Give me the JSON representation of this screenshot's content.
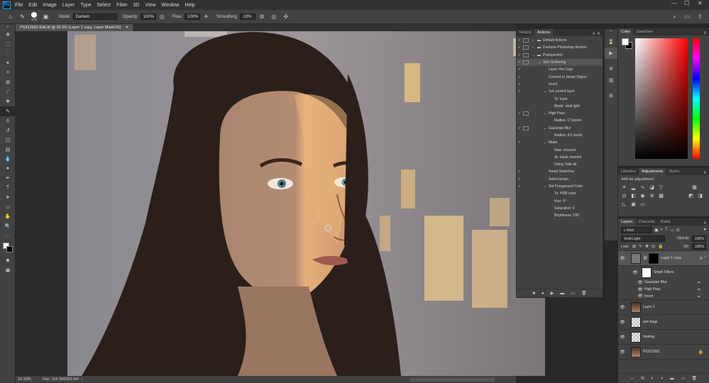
{
  "app": {
    "logo": "Ps"
  },
  "menu": [
    "File",
    "Edit",
    "Image",
    "Layer",
    "Type",
    "Select",
    "Filter",
    "3D",
    "View",
    "Window",
    "Help"
  ],
  "window_controls": {
    "minimize": "—",
    "maximize": "☐",
    "close": "✕"
  },
  "options": {
    "brush_size": "175",
    "mode_label": "Mode:",
    "mode_value": "Darken",
    "opacity_label": "Opacity:",
    "opacity_value": "100%",
    "flow_label": "Flow:",
    "flow_value": "100%",
    "smoothing_label": "Smoothing:",
    "smoothing_value": "10%"
  },
  "document": {
    "tab_title": "PS312992-Edit.tif @ 33.3% (Layer 1 copy, Layer Mask/16)",
    "zoom": "33.33%",
    "doc_size": "Doc: 115.3M/363.6M"
  },
  "actions_panel": {
    "tabs": [
      "History",
      "Actions"
    ],
    "active_tab": "Actions",
    "rows": [
      {
        "indent": 0,
        "folder": true,
        "expand": "›",
        "label": "Default Actions",
        "check": true,
        "dlg": true
      },
      {
        "indent": 0,
        "folder": true,
        "expand": "›",
        "label": "Duotone Photoshop Actions",
        "check": true,
        "dlg": true
      },
      {
        "indent": 0,
        "folder": true,
        "expand": "⌄",
        "label": "Piximperfect",
        "check": true,
        "dlg": true
      },
      {
        "indent": 1,
        "folder": false,
        "expand": "⌄",
        "label": "Skin Softening",
        "check": true,
        "dlg": true,
        "highlight": true
      },
      {
        "indent": 2,
        "folder": false,
        "expand": "",
        "label": "Layer Via Copy",
        "check": true,
        "dlg": false
      },
      {
        "indent": 2,
        "folder": false,
        "expand": "",
        "label": "Convert to Smart Object",
        "check": true,
        "dlg": false
      },
      {
        "indent": 2,
        "folder": false,
        "expand": "",
        "label": "Invert",
        "check": true,
        "dlg": false
      },
      {
        "indent": 2,
        "folder": false,
        "expand": "⌄",
        "label": "Set current layer",
        "check": true,
        "dlg": false
      },
      {
        "indent": 3,
        "folder": false,
        "expand": "",
        "label": "To: layer",
        "check": false,
        "dlg": false
      },
      {
        "indent": 3,
        "folder": false,
        "expand": "",
        "label": "Mode: vivid light",
        "check": false,
        "dlg": false
      },
      {
        "indent": 2,
        "folder": false,
        "expand": "⌄",
        "label": "High Pass",
        "check": true,
        "dlg": true
      },
      {
        "indent": 3,
        "folder": false,
        "expand": "",
        "label": "Radius: 17 pixels",
        "check": false,
        "dlg": false
      },
      {
        "indent": 2,
        "folder": false,
        "expand": "⌄",
        "label": "Gaussian Blur",
        "check": true,
        "dlg": true
      },
      {
        "indent": 3,
        "folder": false,
        "expand": "",
        "label": "Radius: 4.5 pixels",
        "check": false,
        "dlg": false
      },
      {
        "indent": 2,
        "folder": false,
        "expand": "⌄",
        "label": "Make",
        "check": true,
        "dlg": false
      },
      {
        "indent": 3,
        "folder": false,
        "expand": "",
        "label": "New: channel",
        "check": false,
        "dlg": false
      },
      {
        "indent": 3,
        "folder": false,
        "expand": "",
        "label": "At: mask channel",
        "check": false,
        "dlg": false
      },
      {
        "indent": 3,
        "folder": false,
        "expand": "",
        "label": "Using: hide all",
        "check": false,
        "dlg": false
      },
      {
        "indent": 2,
        "folder": false,
        "expand": "",
        "label": "Reset Swatches",
        "check": true,
        "dlg": false
      },
      {
        "indent": 2,
        "folder": false,
        "expand": "",
        "label": "Select brush",
        "check": true,
        "dlg": false
      },
      {
        "indent": 2,
        "folder": false,
        "expand": "⌄",
        "label": "Set Foreground Color",
        "check": true,
        "dlg": false
      },
      {
        "indent": 3,
        "folder": false,
        "expand": "",
        "label": "To: HSB color",
        "check": false,
        "dlg": false
      },
      {
        "indent": 3,
        "folder": false,
        "expand": "",
        "label": "Hue: 0°",
        "check": false,
        "dlg": false
      },
      {
        "indent": 3,
        "folder": false,
        "expand": "",
        "label": "Saturation: 0",
        "check": false,
        "dlg": false
      },
      {
        "indent": 3,
        "folder": false,
        "expand": "",
        "label": "Brightness: 100",
        "check": false,
        "dlg": false
      }
    ],
    "footer_icons": [
      "■",
      "●",
      "▶",
      "▬",
      "▭",
      "🗑"
    ]
  },
  "color_panel": {
    "tabs": [
      "Color",
      "Swatches"
    ],
    "active_tab": "Color",
    "fg": "#ffffff",
    "bg": "#000000",
    "hue_color": "#ff0000"
  },
  "adjustments_panel": {
    "tabs": [
      "Libraries",
      "Adjustments",
      "Styles"
    ],
    "active_tab": "Adjustments",
    "hint": "Add an adjustment"
  },
  "layers_panel": {
    "tabs": [
      "Layers",
      "Channels",
      "Paths"
    ],
    "active_tab": "Layers",
    "filter": "Kind",
    "blend_mode": "Vivid Light",
    "opacity_label": "Opacity:",
    "opacity": "100%",
    "lock_label": "Lock:",
    "fill_label": "Fill:",
    "fill": "100%",
    "layers": [
      {
        "name": "Layer 1 copy",
        "type": "smart",
        "selected": true
      },
      {
        "name": "Layer 1",
        "type": "photo"
      },
      {
        "name": "eye bags",
        "type": "empty"
      },
      {
        "name": "healing",
        "type": "empty"
      },
      {
        "name": "PS312992",
        "type": "photo",
        "locked": true
      }
    ],
    "smart_filters_label": "Smart Filters",
    "filters": [
      "Gaussian Blur",
      "High Pass",
      "Invert"
    ],
    "footer_icons": [
      "⇔",
      "fx",
      "◐",
      "◑",
      "▬",
      "▭",
      "🗑"
    ]
  }
}
